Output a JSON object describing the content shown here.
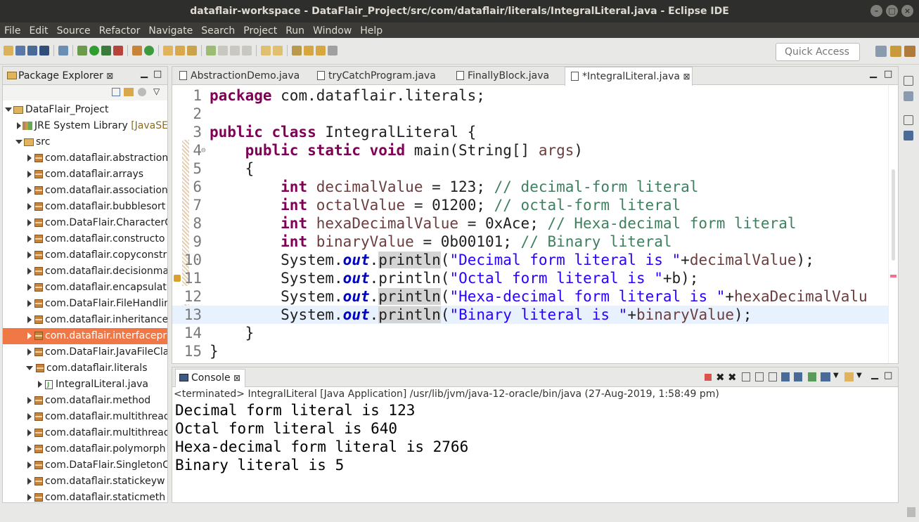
{
  "window": {
    "title": "dataflair-workspace - DataFlair_Project/src/com/dataflair/literals/IntegralLiteral.java - Eclipse IDE"
  },
  "menu": [
    "File",
    "Edit",
    "Source",
    "Refactor",
    "Navigate",
    "Search",
    "Project",
    "Run",
    "Window",
    "Help"
  ],
  "toolbar": {
    "quick_access_placeholder": "Quick Access"
  },
  "package_explorer": {
    "title": "Package Explorer",
    "items": [
      {
        "label": "DataFlair_Project",
        "icon": "project-icon",
        "expanded": true
      },
      {
        "label": "JRE System Library",
        "extra": "[JavaSE-",
        "icon": "library-icon"
      },
      {
        "label": "src",
        "icon": "source-folder-icon",
        "expanded": true
      },
      {
        "label": "com.dataflair.abstraction",
        "icon": "package-icon"
      },
      {
        "label": "com.dataflair.arrays",
        "icon": "package-icon"
      },
      {
        "label": "com.dataflair.association",
        "icon": "package-icon"
      },
      {
        "label": "com.dataflair.bubblesort",
        "icon": "package-icon"
      },
      {
        "label": "com.DataFlair.CharacterC",
        "icon": "package-icon"
      },
      {
        "label": "com.dataflair.constructo",
        "icon": "package-icon"
      },
      {
        "label": "com.dataflair.copyconstr",
        "icon": "package-icon"
      },
      {
        "label": "com.dataflair.decisionma",
        "icon": "package-icon"
      },
      {
        "label": "com.dataflair.encapsulat",
        "icon": "package-icon"
      },
      {
        "label": "com.DataFlair.FileHandlin",
        "icon": "package-icon"
      },
      {
        "label": "com.dataflair.inheritance",
        "icon": "package-icon"
      },
      {
        "label": "com.dataflair.interfacepr",
        "icon": "package-icon",
        "selected": true
      },
      {
        "label": "com.DataFlair.JavaFileCla",
        "icon": "package-icon"
      },
      {
        "label": "com.dataflair.literals",
        "icon": "package-icon",
        "expanded": true
      },
      {
        "label": "IntegralLiteral.java",
        "icon": "java-file-icon"
      },
      {
        "label": "com.dataflair.method",
        "icon": "package-icon"
      },
      {
        "label": "com.dataflair.multithread",
        "icon": "package-icon"
      },
      {
        "label": "com.dataflair.multithread",
        "icon": "package-icon"
      },
      {
        "label": "com.dataflair.polymorph",
        "icon": "package-icon"
      },
      {
        "label": "com.DataFlair.SingletonC",
        "icon": "package-icon"
      },
      {
        "label": "com.dataflair.statickeyw",
        "icon": "package-icon"
      },
      {
        "label": "com.dataflair.staticmeth",
        "icon": "package-icon"
      }
    ]
  },
  "editor": {
    "tabs": [
      "AbstractionDemo.java",
      "tryCatchProgram.java",
      "FinallyBlock.java",
      "*IntegralLiteral.java"
    ],
    "active_tab": 3,
    "line_numbers": [
      "1",
      "2",
      "3",
      "4",
      "5",
      "6",
      "7",
      "8",
      "9",
      "10",
      "11",
      "12",
      "13",
      "14",
      "15"
    ],
    "code": {
      "l1_kw": "package",
      "l1_rest": " com.dataflair.literals;",
      "l3_kw": "public class",
      "l3_rest": " IntegralLiteral {",
      "l4_kw": "public static void",
      "l4_rest": " main(String[] ",
      "l4_var": "args",
      "l4_end": ")",
      "l5": "{",
      "int_kw": "int",
      "l6_var": "decimalValue",
      "l6_rest": " = 123; ",
      "l6_comment": "// decimal-form literal",
      "l7_var": "octalValue",
      "l7_rest": " = 01200; ",
      "l7_comment": "// octal-form literal",
      "l8_var": "hexaDecimalValue",
      "l8_rest": " = 0xAce; ",
      "l8_comment": "// Hexa-decimal form literal",
      "l9_var": "binaryValue",
      "l9_rest": " = 0b00101; ",
      "l9_comment": "// Binary literal",
      "sys": "System.",
      "out": "out",
      "dot": ".",
      "println": "println",
      "paren": "(",
      "l10_str": "\"Decimal form literal is \"",
      "l10_rest": "+",
      "l10_var": "decimalValue",
      "l10_end": ");",
      "l11_str": "\"Octal form literal is \"",
      "l11_rest": "+b);",
      "l12_str": "\"Hexa-decimal form literal is \"",
      "l12_rest": "+",
      "l12_var": "hexaDecimalValu",
      "l13_str": "\"Binary literal is \"",
      "l13_rest": "+",
      "l13_var": "binaryValue",
      "l13_end": ");",
      "l14": "}",
      "l15": "}"
    }
  },
  "console": {
    "title": "Console",
    "status": "<terminated> IntegralLiteral [Java Application] /usr/lib/jvm/java-12-oracle/bin/java (27-Aug-2019, 1:58:49 pm)",
    "output": [
      "Decimal form literal is 123",
      "Octal form literal is 640",
      "Hexa-decimal form literal is 2766",
      "Binary literal is 5"
    ]
  }
}
